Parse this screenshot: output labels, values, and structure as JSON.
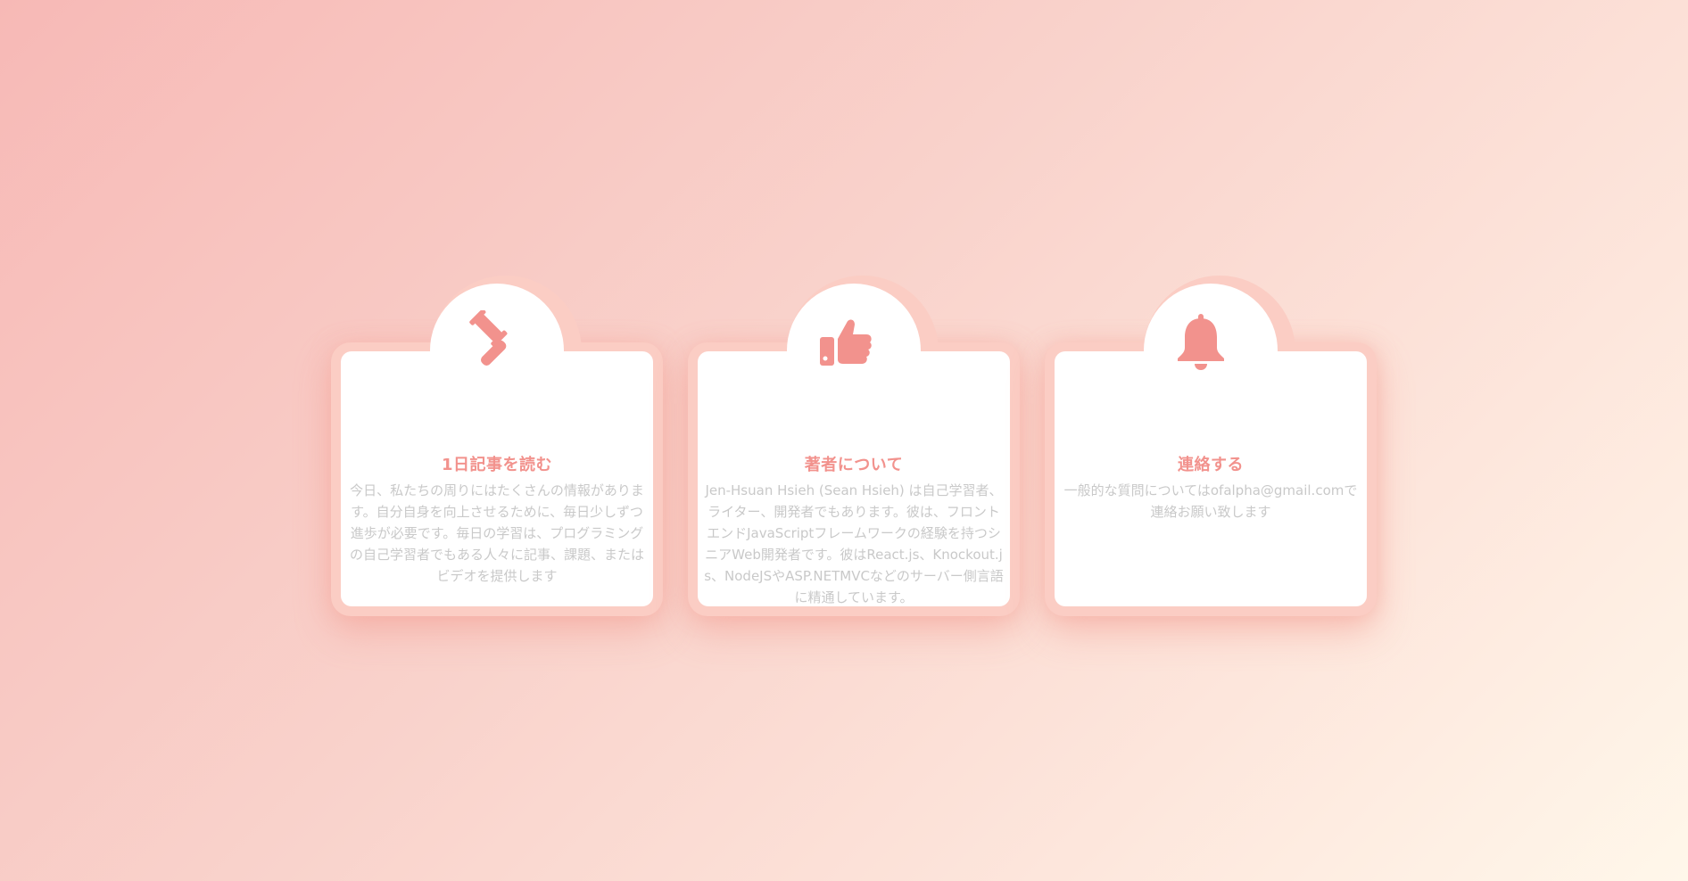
{
  "theme": {
    "accent": "#f2928d",
    "card_background": "#ffffff",
    "frame_color": "#fbcdc4",
    "body_text": "#c9c9c9"
  },
  "cards": [
    {
      "icon": "gavel-icon",
      "title": "1日記事を読む",
      "description": "今日、私たちの周りにはたくさんの情報があります。自分自身を向上させるために、毎日少しずつ進歩が必要です。毎日の学習は、プログラミングの自己学習者でもある人々に記事、課題、またはビデオを提供します"
    },
    {
      "icon": "thumbs-up-icon",
      "title": "著者について",
      "description": "Jen-Hsuan Hsieh (Sean Hsieh) は自己学習者、ライター、開発者でもあります。彼は、フロントエンドJavaScriptフレームワークの経験を持つシニアWeb開発者です。彼はReact.js、Knockout.js、NodeJSやASP.NETMVCなどのサーバー側言語に精通しています。"
    },
    {
      "icon": "bell-icon",
      "title": "連絡する",
      "description": "一般的な質問についてはofalpha@gmail.comで連絡お願い致します"
    }
  ]
}
